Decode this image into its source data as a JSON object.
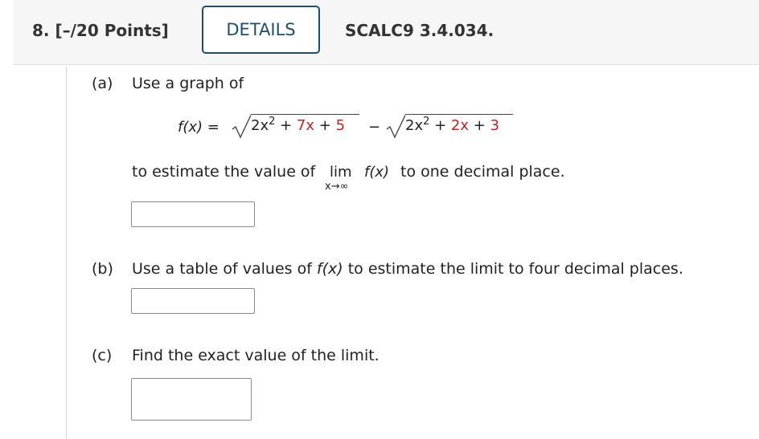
{
  "header": {
    "question_label": "8. [–/20 Points]",
    "details_label": "DETAILS",
    "problem_id": "SCALC9 3.4.034."
  },
  "part_a": {
    "label": "(a)",
    "intro": "Use a graph of",
    "function": {
      "lhs": "f(x) =",
      "rad1_term1": "2x",
      "rad1_exp": "2",
      "rad1_plus1": " + ",
      "rad1_term2": "7x",
      "rad1_plus2": " + ",
      "rad1_term3": "5",
      "minus": "−",
      "rad2_term1": "2x",
      "rad2_exp": "2",
      "rad2_plus1": " + ",
      "rad2_term2": "2x",
      "rad2_plus2": " + ",
      "rad2_term3": "3"
    },
    "estimate_pre": "to estimate the value of",
    "limit_word": "lim",
    "limit_sub": "x→∞",
    "limit_expr": "f(x)",
    "estimate_post": "to one decimal place.",
    "answer_value": ""
  },
  "part_b": {
    "label": "(b)",
    "text_pre": "Use a table of values of ",
    "text_fx": "f(x)",
    "text_post": " to estimate the limit to four decimal places.",
    "answer_value": ""
  },
  "part_c": {
    "label": "(c)",
    "text": "Find the exact value of the limit.",
    "answer_value": ""
  },
  "colors": {
    "details_border": "#1b4f72",
    "highlight_red": "#cc1f1f",
    "header_bg": "#f6f6f6"
  }
}
